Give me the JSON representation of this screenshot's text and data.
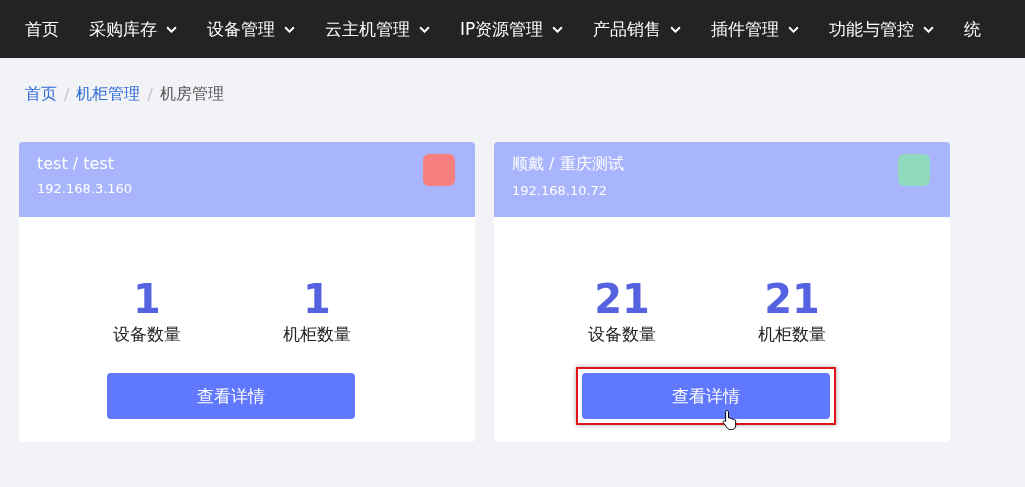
{
  "nav": [
    {
      "label": "首页",
      "dropdown": false
    },
    {
      "label": "采购库存",
      "dropdown": true
    },
    {
      "label": "设备管理",
      "dropdown": true
    },
    {
      "label": "云主机管理",
      "dropdown": true
    },
    {
      "label": "IP资源管理",
      "dropdown": true
    },
    {
      "label": "产品销售",
      "dropdown": true
    },
    {
      "label": "插件管理",
      "dropdown": true
    },
    {
      "label": "功能与管控",
      "dropdown": true
    },
    {
      "label": "统",
      "dropdown": false
    }
  ],
  "breadcrumb": [
    {
      "label": "首页",
      "link": true
    },
    {
      "separator": "/",
      "label": "机柜管理",
      "link": true
    },
    {
      "separator": "/",
      "label": "机房管理",
      "link": false
    }
  ],
  "cards": [
    {
      "title": "test / test",
      "ip": "192.168.3.160",
      "color": "#f77f7f",
      "stats": [
        {
          "value": "1",
          "label": "设备数量"
        },
        {
          "value": "1",
          "label": "机柜数量"
        }
      ],
      "button": "查看详情",
      "highlighted": false
    },
    {
      "title": "顺戴 / 重庆测试",
      "ip": "192.168.10.72",
      "color": "#90dbbd",
      "stats": [
        {
          "value": "21",
          "label": "设备数量"
        },
        {
          "value": "21",
          "label": "机柜数量"
        }
      ],
      "button": "查看详情",
      "highlighted": true
    }
  ]
}
